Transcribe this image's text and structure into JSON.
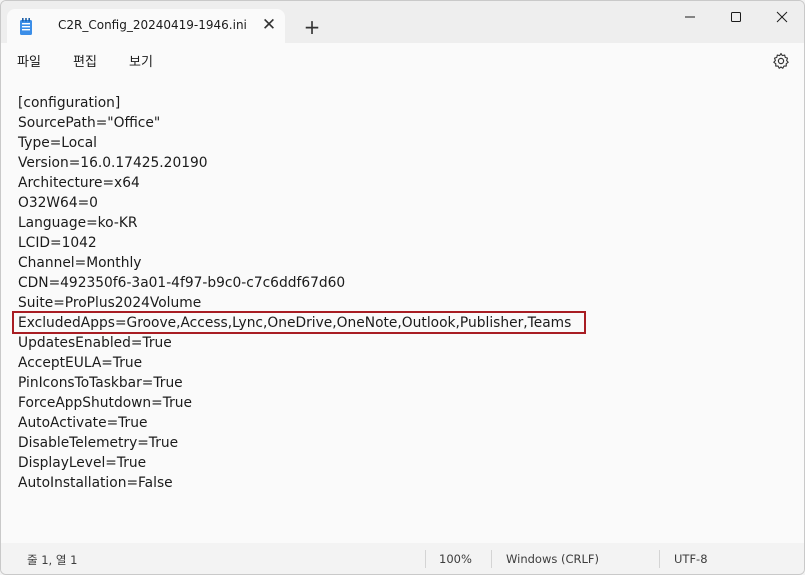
{
  "window": {
    "tab_title": "C2R_Config_20240419-1946.ini",
    "tab_icon": "notepad-icon",
    "close_tab_glyph": "✕",
    "new_tab_glyph": "+"
  },
  "menu": {
    "file": "파일",
    "edit": "편집",
    "view": "보기"
  },
  "editor": {
    "lines": [
      "[configuration]",
      "SourcePath=\"Office\"",
      "Type=Local",
      "Version=16.0.17425.20190",
      "Architecture=x64",
      "O32W64=0",
      "Language=ko-KR",
      "LCID=1042",
      "Channel=Monthly",
      "CDN=492350f6-3a01-4f97-b9c0-c7c6ddf67d60",
      "Suite=ProPlus2024Volume",
      "ExcludedApps=Groove,Access,Lync,OneDrive,OneNote,Outlook,Publisher,Teams",
      "UpdatesEnabled=True",
      "AcceptEULA=True",
      "PinIconsToTaskbar=True",
      "ForceAppShutdown=True",
      "AutoActivate=True",
      "DisableTelemetry=True",
      "DisplayLevel=True",
      "AutoInstallation=False"
    ],
    "highlight_color": "#a81d23"
  },
  "status": {
    "position": "줄 1, 열 1",
    "zoom": "100%",
    "line_ending": "Windows (CRLF)",
    "encoding": "UTF-8"
  }
}
